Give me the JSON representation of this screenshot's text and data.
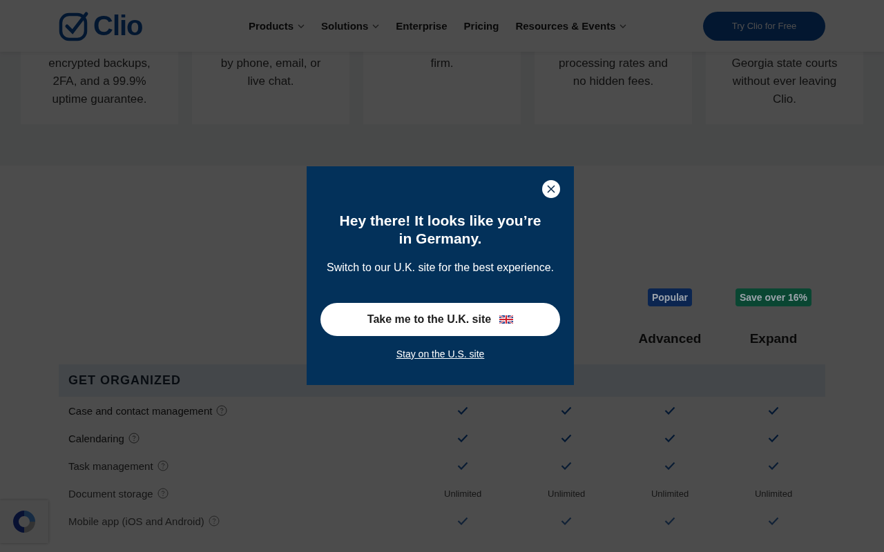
{
  "header": {
    "logo": "Clio",
    "nav": [
      {
        "label": "Products",
        "dropdown": true
      },
      {
        "label": "Solutions",
        "dropdown": true
      },
      {
        "label": "Enterprise",
        "dropdown": false
      },
      {
        "label": "Pricing",
        "dropdown": false
      },
      {
        "label": "Resources & Events",
        "dropdown": true
      }
    ],
    "cta": "Try Clio for Free"
  },
  "feature_cards": [
    {
      "text": "encrypted backups, 2FA, and a 99.9% uptime guarantee."
    },
    {
      "text": "by phone, email, or live chat."
    },
    {
      "text": "firm."
    },
    {
      "text": "processing rates and no hidden fees."
    },
    {
      "text": "Georgia state courts without ever leaving Clio."
    }
  ],
  "plans": [
    {
      "name": "Advanced",
      "badge": "Popular",
      "color": "#0b2550"
    },
    {
      "name": "Expand",
      "badge": "Save over 16%",
      "color": "#0a4632"
    }
  ],
  "table": {
    "section": "GET ORGANIZED",
    "rows": [
      {
        "feature": "Case and contact management",
        "cells": [
          {
            "kind": "check"
          },
          {
            "kind": "check"
          },
          {
            "kind": "check"
          },
          {
            "kind": "check"
          }
        ]
      },
      {
        "feature": "Calendaring",
        "cells": [
          {
            "kind": "check"
          },
          {
            "kind": "check"
          },
          {
            "kind": "check"
          },
          {
            "kind": "check"
          }
        ]
      },
      {
        "feature": "Task management",
        "cells": [
          {
            "kind": "check"
          },
          {
            "kind": "check"
          },
          {
            "kind": "check"
          },
          {
            "kind": "check"
          }
        ]
      },
      {
        "feature": "Document storage",
        "cells": [
          {
            "kind": "text",
            "text": "Unlimited"
          },
          {
            "kind": "text",
            "text": "Unlimited"
          },
          {
            "kind": "text",
            "text": "Unlimited"
          },
          {
            "kind": "text",
            "text": "Unlimited"
          }
        ]
      },
      {
        "feature": "Mobile app (iOS and Android)",
        "cells": [
          {
            "kind": "check"
          },
          {
            "kind": "check"
          },
          {
            "kind": "check"
          },
          {
            "kind": "check"
          }
        ]
      }
    ]
  },
  "modal": {
    "title": "Hey there! It looks like you’re in Germany.",
    "message": "Switch to our U.K. site for the best experience.",
    "primary_button": "Take me to the U.K. site",
    "secondary_link": "Stay on the U.S. site"
  }
}
